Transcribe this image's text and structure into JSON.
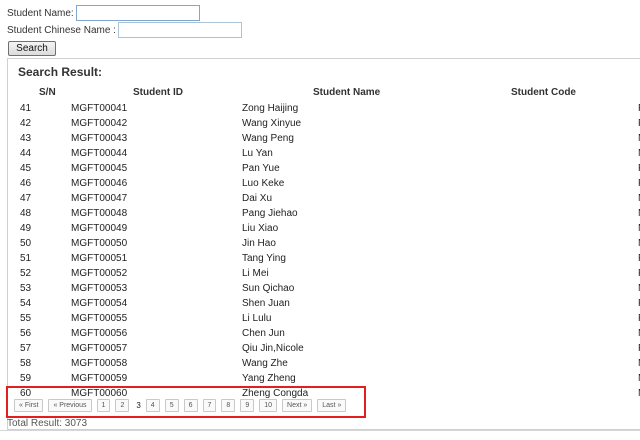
{
  "form": {
    "student_name_label": "Student Name:",
    "student_name_value": "",
    "chinese_name_label": "Student Chinese Name :",
    "chinese_name_value": "",
    "search_label": "Search"
  },
  "results": {
    "title": "Search Result:",
    "columns": [
      "S/N",
      "Student ID",
      "Student Name",
      "Student Code"
    ],
    "rows": [
      {
        "sn": "41",
        "id": "MGFT00041",
        "name": "Zong Haijing",
        "g": "F"
      },
      {
        "sn": "42",
        "id": "MGFT00042",
        "name": "Wang Xinyue",
        "g": "F"
      },
      {
        "sn": "43",
        "id": "MGFT00043",
        "name": "Wang Peng",
        "g": "M"
      },
      {
        "sn": "44",
        "id": "MGFT00044",
        "name": "Lu Yan",
        "g": "M"
      },
      {
        "sn": "45",
        "id": "MGFT00045",
        "name": "Pan Yue",
        "g": "F"
      },
      {
        "sn": "46",
        "id": "MGFT00046",
        "name": "Luo Keke",
        "g": "F"
      },
      {
        "sn": "47",
        "id": "MGFT00047",
        "name": "Dai Xu",
        "g": "M"
      },
      {
        "sn": "48",
        "id": "MGFT00048",
        "name": "Pang Jiehao",
        "g": "M"
      },
      {
        "sn": "49",
        "id": "MGFT00049",
        "name": "Liu Xiao",
        "g": "M"
      },
      {
        "sn": "50",
        "id": "MGFT00050",
        "name": "Jin Hao",
        "g": "M"
      },
      {
        "sn": "51",
        "id": "MGFT00051",
        "name": "Tang Ying",
        "g": "F"
      },
      {
        "sn": "52",
        "id": "MGFT00052",
        "name": "Li Mei",
        "g": "F"
      },
      {
        "sn": "53",
        "id": "MGFT00053",
        "name": "Sun Qichao",
        "g": "M"
      },
      {
        "sn": "54",
        "id": "MGFT00054",
        "name": "Shen Juan",
        "g": "F"
      },
      {
        "sn": "55",
        "id": "MGFT00055",
        "name": "Li Lulu",
        "g": "F"
      },
      {
        "sn": "56",
        "id": "MGFT00056",
        "name": "Chen Jun",
        "g": "M"
      },
      {
        "sn": "57",
        "id": "MGFT00057",
        "name": "Qiu Jin,Nicole",
        "g": "F"
      },
      {
        "sn": "58",
        "id": "MGFT00058",
        "name": "Wang Zhe",
        "g": "M"
      },
      {
        "sn": "59",
        "id": "MGFT00059",
        "name": "Yang Zheng",
        "g": "M"
      },
      {
        "sn": "60",
        "id": "MGFT00060",
        "name": "Zheng Congda",
        "g": "M"
      }
    ]
  },
  "pager": {
    "first": "« First",
    "previous": "« Previous",
    "pages": [
      "1",
      "2",
      "3",
      "4",
      "5",
      "6",
      "7",
      "8",
      "9",
      "10"
    ],
    "current": "3",
    "next": "Next »",
    "last": "Last »"
  },
  "total": "Total Result: 3073",
  "colors": {
    "highlight_box": "#e31e1e",
    "input_border": "#7fa7d0"
  }
}
